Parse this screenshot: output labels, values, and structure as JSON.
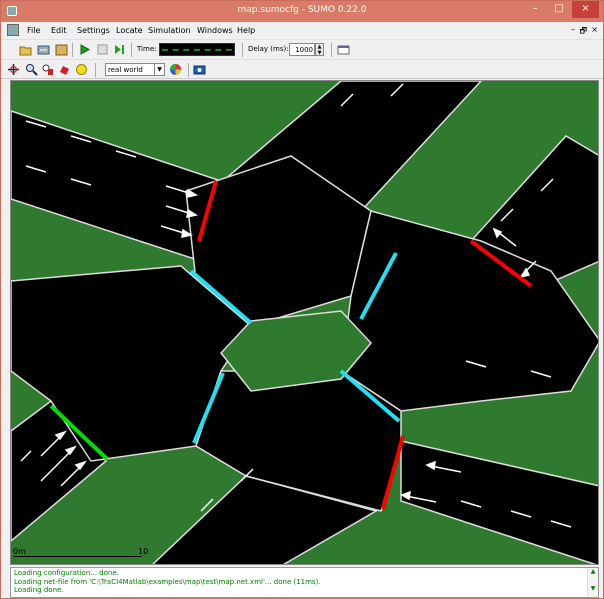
{
  "window": {
    "title": "map.sumocfg - SUMO 0.22.0",
    "controls": [
      "–",
      "□",
      "×"
    ]
  },
  "menubar": {
    "items": [
      {
        "label": "File"
      },
      {
        "label": "Edit"
      },
      {
        "label": "Settings"
      },
      {
        "label": "Locate"
      },
      {
        "label": "Simulation"
      },
      {
        "label": "Windows"
      },
      {
        "label": "Help"
      }
    ],
    "mdi_controls": [
      "–",
      "🗗",
      "×"
    ]
  },
  "toolbar": {
    "time_label": "Time:",
    "delay_label": "Delay (ms):",
    "delay_value": "1000",
    "viewport_scheme": "real world"
  },
  "canvas": {
    "scale_start": "0m",
    "scale_end": "10"
  },
  "log": {
    "lines": [
      "Loading configuration... done.",
      "Loading net-file from 'C:\\TraCI4Matlab\\examples\\map\\test\\map.net.xml'... done (11ms).",
      "Loading done."
    ]
  },
  "colors": {
    "grass": "#2f7a2f",
    "road": "#000000",
    "signal_red": "#ff0000",
    "signal_green": "#00e000",
    "signal_cyan": "#22e0f0",
    "log_text": "#008000",
    "titlebar": "#d97b66"
  }
}
